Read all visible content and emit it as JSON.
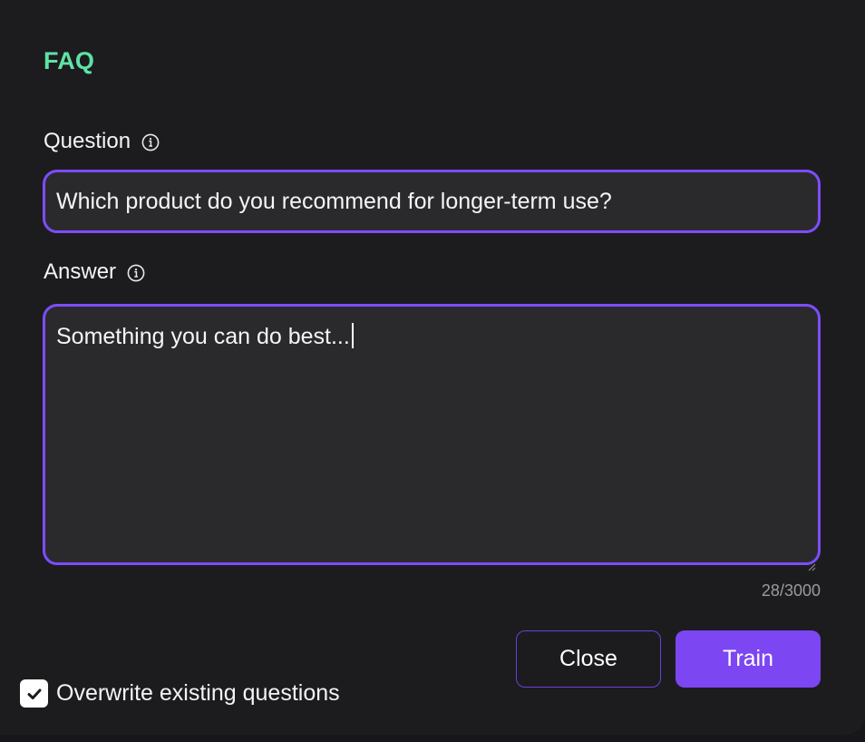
{
  "dialog": {
    "title": "FAQ"
  },
  "question": {
    "label": "Question",
    "value": "Which product do you recommend for longer-term use?"
  },
  "answer": {
    "label": "Answer",
    "value": "Something you can do best...",
    "counter": "28/3000"
  },
  "buttons": {
    "close_label": "Close",
    "train_label": "Train"
  },
  "overwrite": {
    "label": "Overwrite existing questions",
    "checked": true
  },
  "colors": {
    "accent": "#7c4dff",
    "title": "#5ee3a4",
    "background": "#1c1c1f",
    "field_background": "#2a2a2d"
  },
  "icons": {
    "info": "info-icon",
    "check": "check-icon"
  }
}
